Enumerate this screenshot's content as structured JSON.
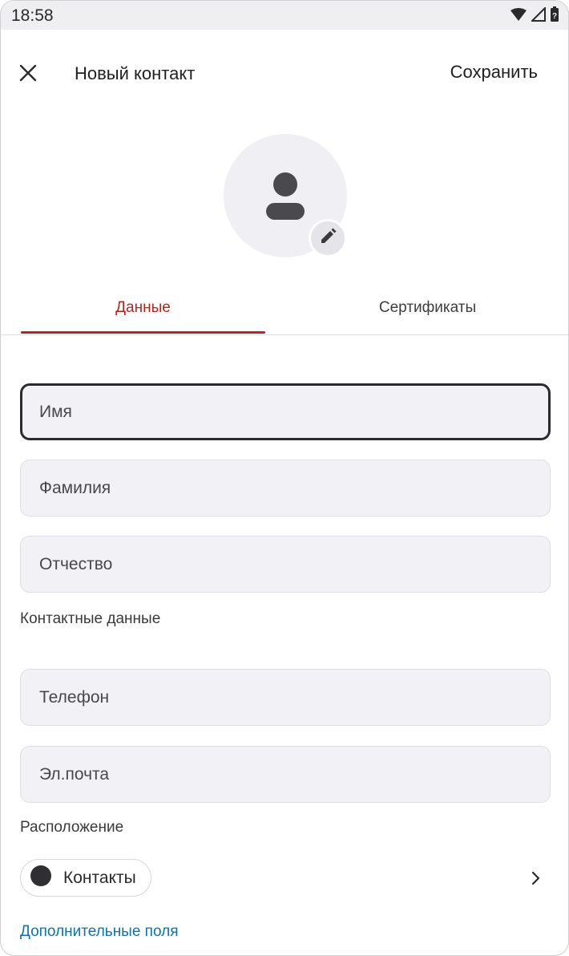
{
  "status_bar": {
    "time": "18:58",
    "icons": [
      "wifi-icon",
      "cellular-signal-icon",
      "battery-icon"
    ]
  },
  "app_bar": {
    "close_icon": "close-icon",
    "title": "Новый контакт",
    "save_label": "Сохранить"
  },
  "avatar": {
    "icon": "person-icon",
    "edit_icon": "pencil-icon"
  },
  "tabs": [
    {
      "label": "Данные",
      "selected": true
    },
    {
      "label": "Сертификаты",
      "selected": false
    }
  ],
  "name_fields": {
    "first_name": {
      "placeholder": "Имя",
      "value": ""
    },
    "last_name": {
      "placeholder": "Фамилия",
      "value": ""
    },
    "middle_name": {
      "placeholder": "Отчество",
      "value": ""
    }
  },
  "contact_section": {
    "label": "Контактные данные",
    "phone": {
      "placeholder": "Телефон",
      "value": ""
    },
    "email": {
      "placeholder": "Эл.почта",
      "value": ""
    }
  },
  "location_section": {
    "label": "Расположение",
    "selected": "Контакты",
    "folder_icon": "folder-icon",
    "chevron_icon": "chevron-right-icon"
  },
  "more_fields_link": "Дополнительные поля",
  "colors": {
    "accent": "#b3261e",
    "link": "#0d73a8",
    "field_bg": "#f2f2f6",
    "status_bar_bg": "#efeff2"
  }
}
